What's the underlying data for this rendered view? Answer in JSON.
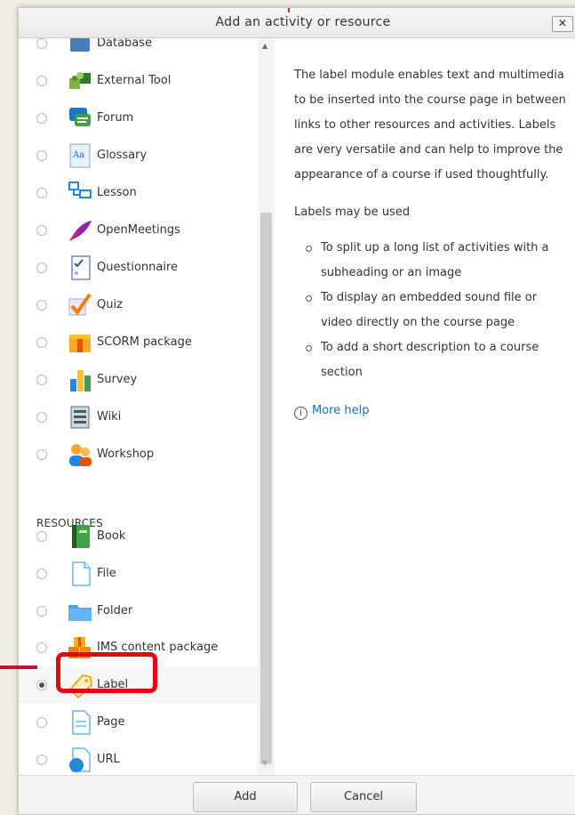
{
  "dialog": {
    "title": "Add an activity or resource",
    "close_label": "✕"
  },
  "activities": [
    {
      "label": "Database",
      "icon": "database-icon"
    },
    {
      "label": "External Tool",
      "icon": "puzzle-icon"
    },
    {
      "label": "Forum",
      "icon": "forum-icon"
    },
    {
      "label": "Glossary",
      "icon": "glossary-icon"
    },
    {
      "label": "Lesson",
      "icon": "lesson-icon"
    },
    {
      "label": "OpenMeetings",
      "icon": "feather-icon"
    },
    {
      "label": "Questionnaire",
      "icon": "questionnaire-icon"
    },
    {
      "label": "Quiz",
      "icon": "checkmark-icon"
    },
    {
      "label": "SCORM package",
      "icon": "scorm-box-icon"
    },
    {
      "label": "Survey",
      "icon": "bar-chart-icon"
    },
    {
      "label": "Wiki",
      "icon": "wiki-icon"
    },
    {
      "label": "Workshop",
      "icon": "people-icon"
    }
  ],
  "resources_heading": "RESOURCES",
  "resources": [
    {
      "label": "Book",
      "icon": "book-icon"
    },
    {
      "label": "File",
      "icon": "file-icon"
    },
    {
      "label": "Folder",
      "icon": "folder-icon"
    },
    {
      "label": "IMS content package",
      "icon": "package-icon"
    },
    {
      "label": "Label",
      "icon": "tag-icon",
      "selected": true
    },
    {
      "label": "Page",
      "icon": "page-icon"
    },
    {
      "label": "URL",
      "icon": "globe-icon"
    }
  ],
  "help": {
    "intro": "The label module enables text and multimedia to be inserted into the course page in between links to other resources and activities. Labels are very versatile and can help to improve the appearance of a course if used thoughtfully.",
    "sub": "Labels may be used",
    "items": [
      "To split up a long list of activities with a subheading or an image",
      "To display an embedded sound file or video directly on the course page",
      "To add a short description to a course section"
    ],
    "more_help": "More help",
    "info_glyph": "i"
  },
  "footer": {
    "add_label": "Add",
    "cancel_label": "Cancel"
  },
  "colors": {
    "highlight": "#e30613",
    "link": "#1b6fb5"
  }
}
